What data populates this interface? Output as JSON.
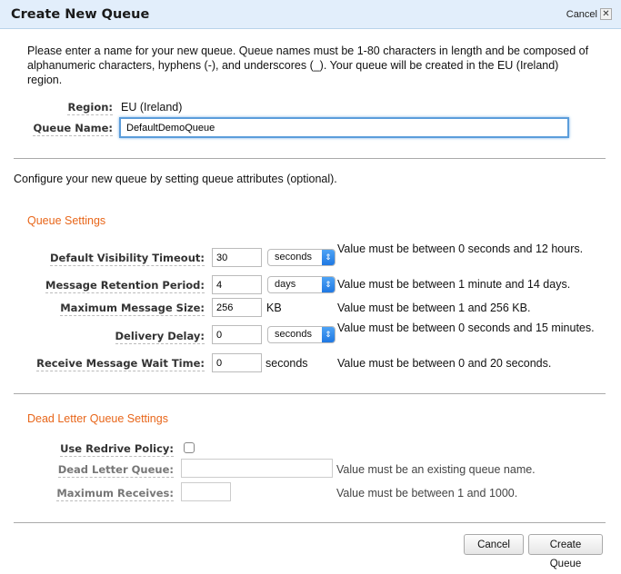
{
  "dialog": {
    "title": "Create New Queue",
    "header_cancel": "Cancel",
    "close_glyph": "✕"
  },
  "intro": "Please enter a name for your new queue. Queue names must be 1-80 characters in length and be composed of alphanumeric characters, hyphens (-), and underscores (_). Your queue will be created in the EU (Ireland) region.",
  "region": {
    "label": "Region:",
    "value": "EU (Ireland)"
  },
  "queue_name": {
    "label": "Queue Name:",
    "value": "DefaultDemoQueue"
  },
  "configure_text": "Configure your new queue by setting queue attributes (optional).",
  "queue_settings": {
    "heading": "Queue Settings",
    "fields": [
      {
        "label": "Default Visibility Timeout:",
        "value": "30",
        "unit": "seconds",
        "help": "Value must be between 0 seconds and 12 hours."
      },
      {
        "label": "Message Retention Period:",
        "value": "4",
        "unit": "days",
        "help": "Value must be between 1 minute and 14 days."
      },
      {
        "label": "Maximum Message Size:",
        "value": "256",
        "unit": "KB",
        "help": "Value must be between 1 and 256 KB."
      },
      {
        "label": "Delivery Delay:",
        "value": "0",
        "unit": "seconds",
        "help": "Value must be between 0 seconds and 15 minutes."
      },
      {
        "label": "Receive Message Wait Time:",
        "value": "0",
        "unit": "seconds",
        "help": "Value must be between 0 and 20 seconds."
      }
    ]
  },
  "dlq_settings": {
    "heading": "Dead Letter Queue Settings",
    "use_redrive": {
      "label": "Use Redrive Policy:",
      "checked": false
    },
    "dead_letter_queue": {
      "label": "Dead Letter Queue:",
      "value": "",
      "help": "Value must be an existing queue name."
    },
    "max_receives": {
      "label": "Maximum Receives:",
      "value": "",
      "help": "Value must be between 1 and 1000."
    }
  },
  "footer": {
    "cancel": "Cancel",
    "create": "Create Queue"
  }
}
